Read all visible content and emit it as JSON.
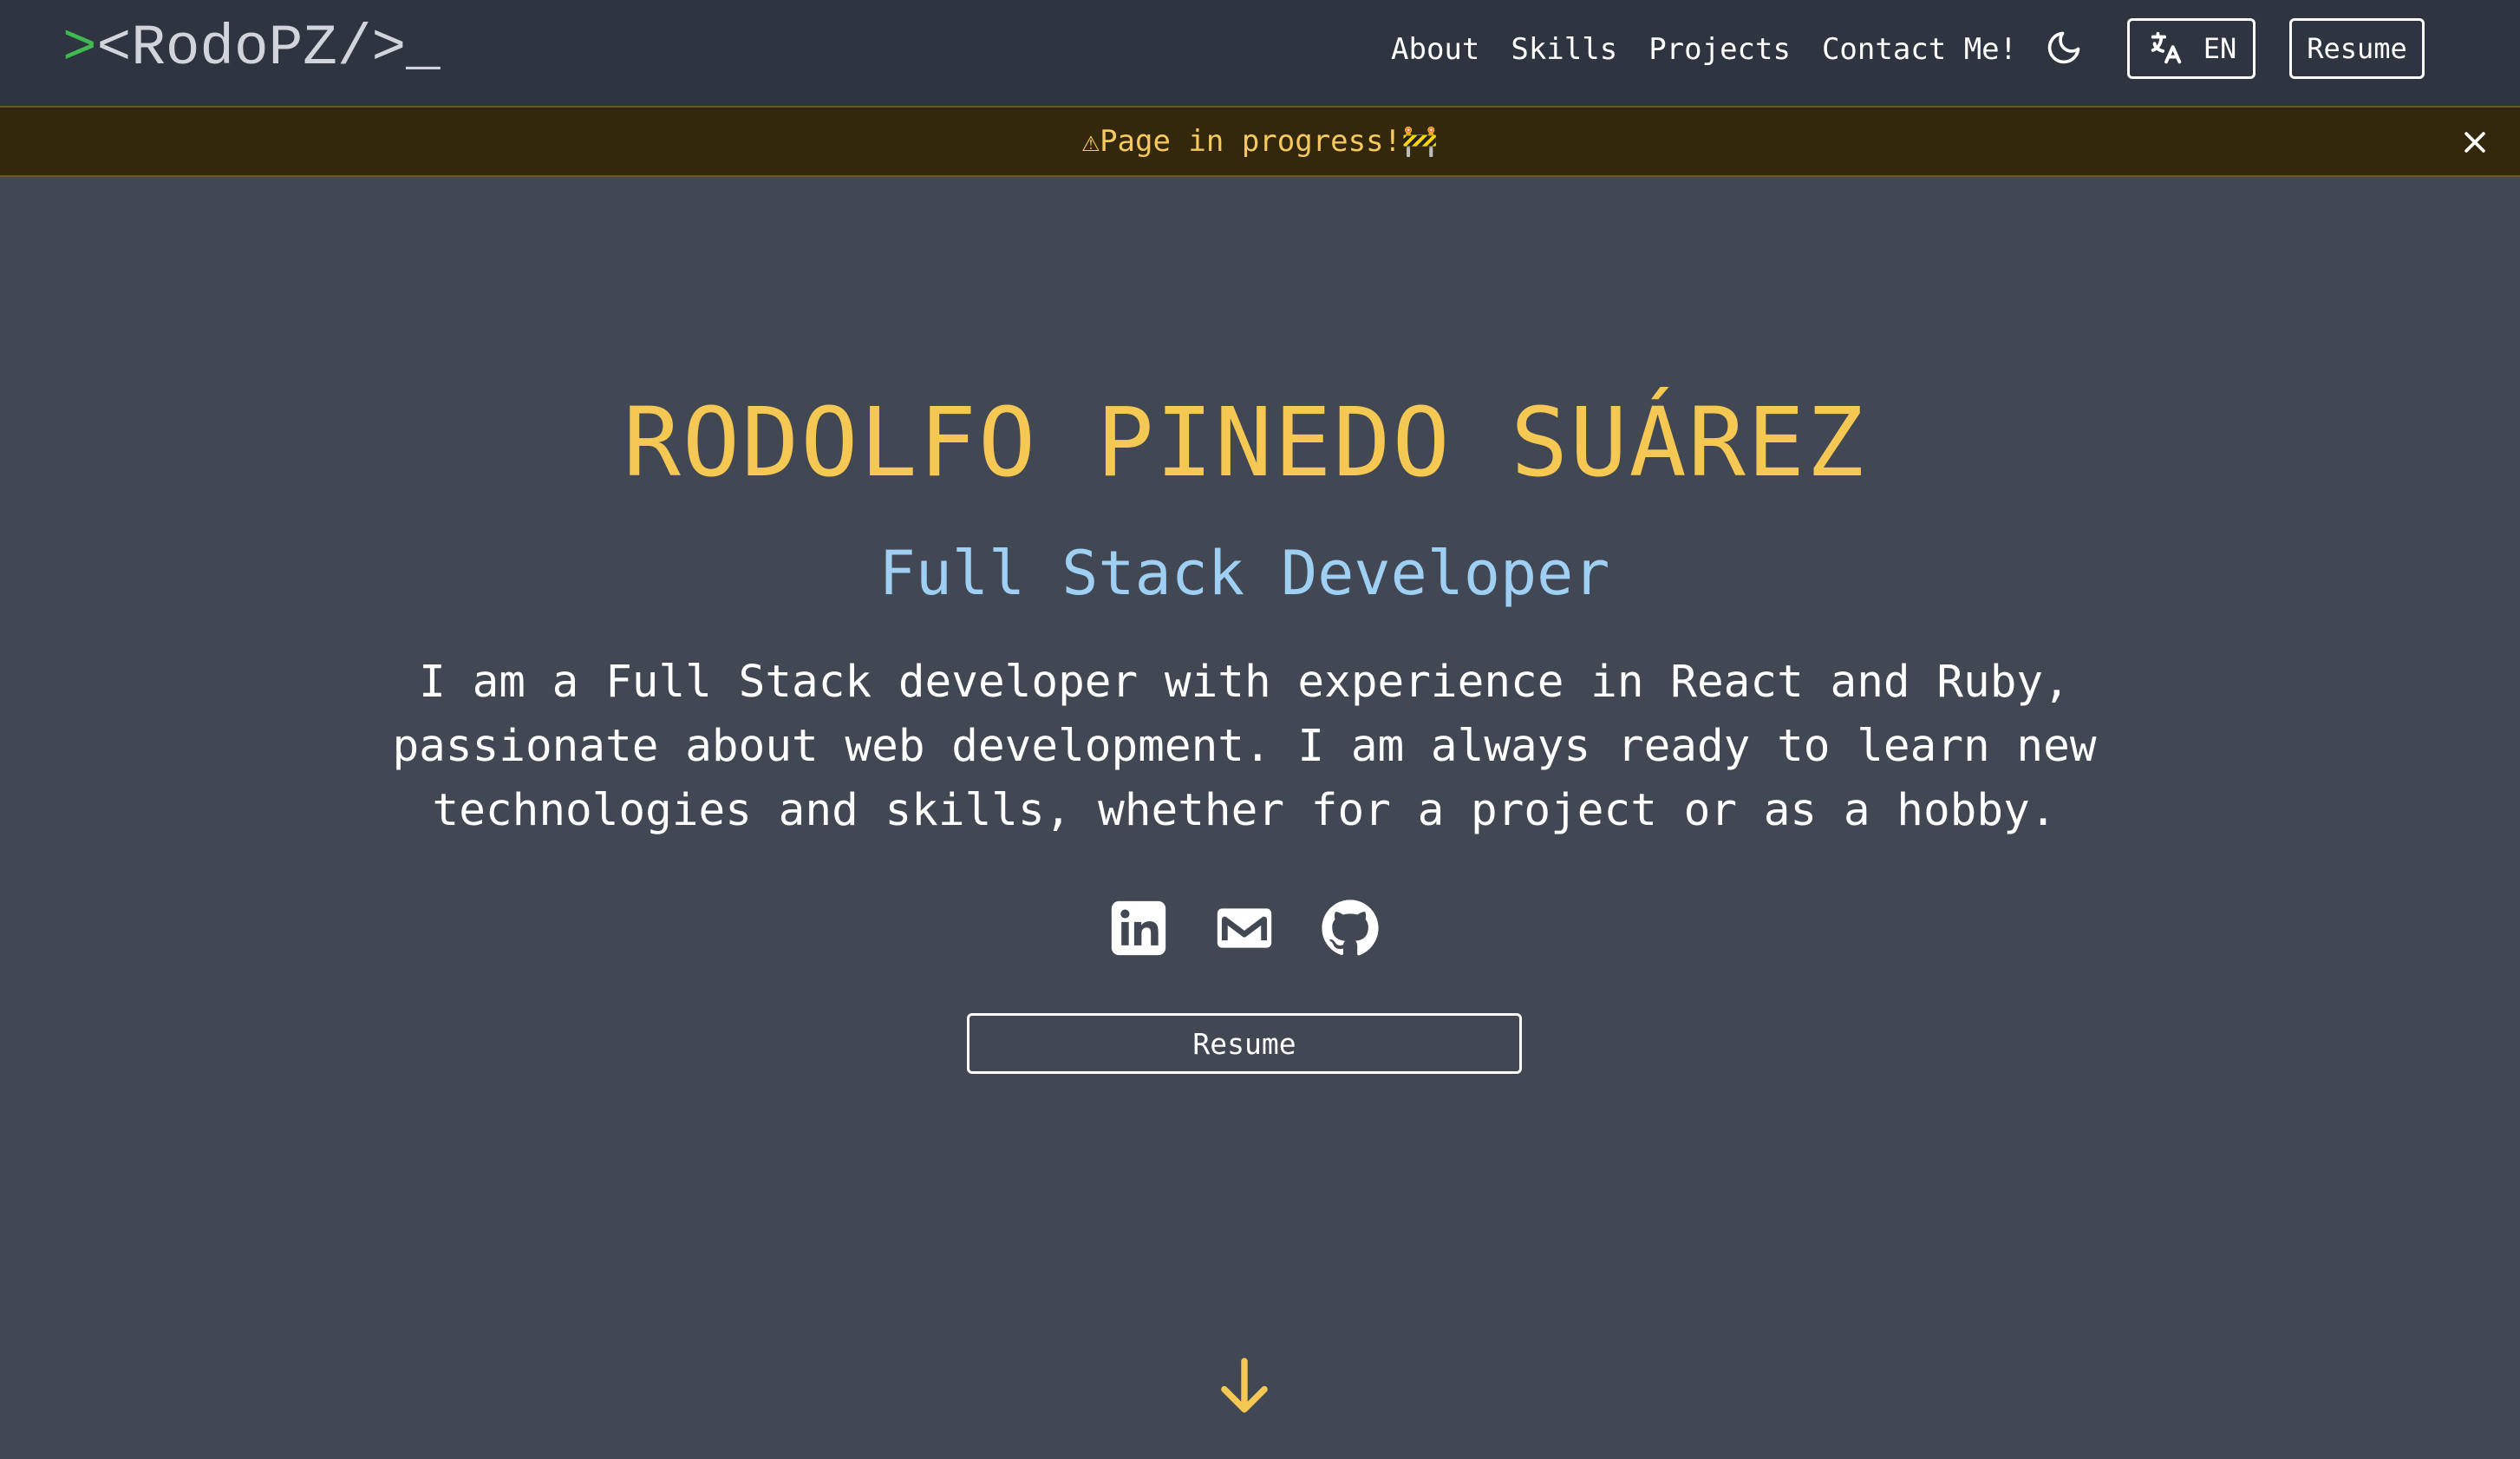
{
  "navbar": {
    "logo_prompt": ">",
    "logo_text": "<RodoPZ/>",
    "logo_cursor": "_",
    "links": [
      "About",
      "Skills",
      "Projects",
      "Contact Me!"
    ],
    "theme_icon": "moon-icon",
    "language": {
      "icon": "translate-icon",
      "label": "EN"
    },
    "resume_label": "Resume"
  },
  "banner": {
    "text": "⚠Page in progress!🚧",
    "close_icon": "close-icon"
  },
  "hero": {
    "name": "RODOLFO PINEDO SUÁREZ",
    "role": "Full Stack Developer",
    "description": "I am a Full Stack developer with experience in React and Ruby, passionate about web development. I am always ready to learn new technologies and skills, whether for a project or as a hobby.",
    "socials": [
      "linkedin-icon",
      "gmail-icon",
      "github-icon"
    ],
    "resume_label": "Resume",
    "scroll_icon": "arrow-down-icon"
  },
  "colors": {
    "background": "#414753",
    "navbar": "#2e3440",
    "accent_yellow": "#f5c853",
    "accent_blue": "#9fd0f3",
    "prompt_green": "#3fb950",
    "banner_bg": "#33280c"
  }
}
